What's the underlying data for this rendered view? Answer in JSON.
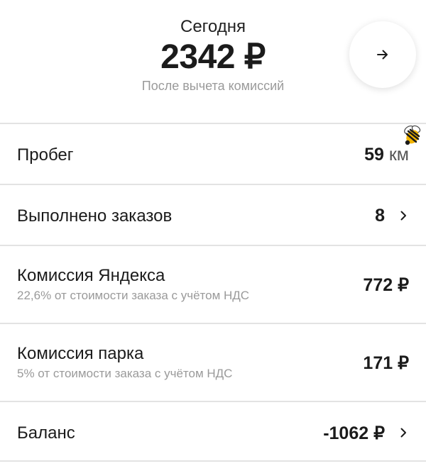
{
  "header": {
    "today_label": "Сегодня",
    "amount": "2342 ₽",
    "note": "После вычета комиссий"
  },
  "rows": [
    {
      "label": "Пробег",
      "value": "59",
      "unit": " км"
    },
    {
      "label": "Выполнено заказов",
      "value": "8"
    },
    {
      "label": "Комиссия Яндекса",
      "sublabel": "22,6% от стоимости заказа с учётом НДС",
      "value": "772 ₽"
    },
    {
      "label": "Комиссия парка",
      "sublabel": "5% от стоимости заказа с учётом НДС",
      "value": "171 ₽"
    },
    {
      "label": "Баланс",
      "value": "-1062 ₽"
    }
  ],
  "icons": {
    "header_button": "arrow-right-icon",
    "row_chevron": "chevron-right-icon",
    "decoration": "bee-icon"
  },
  "colors": {
    "text": "#1b1b1b",
    "secondary_text": "#9a9a9a",
    "divider": "#e3e3e3",
    "background": "#ffffff"
  }
}
